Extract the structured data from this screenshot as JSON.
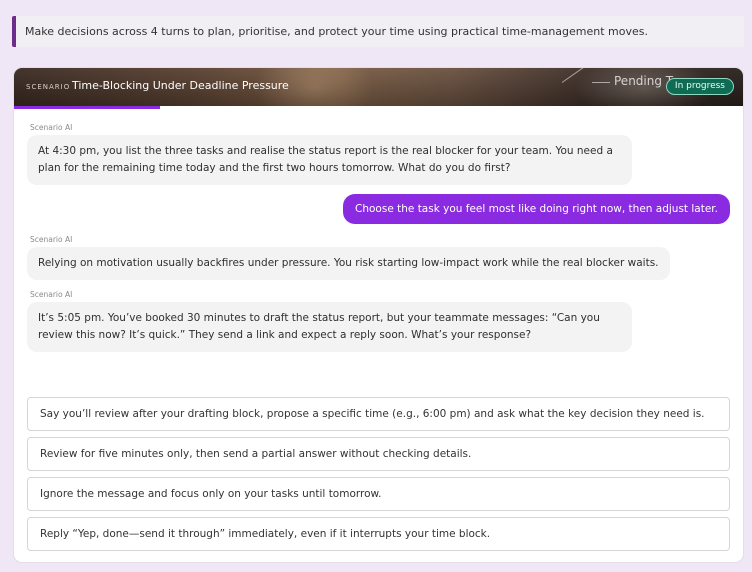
{
  "intro": {
    "text": "Make decisions across 4 turns to plan, prioritise, and protect your time using practical time-management moves."
  },
  "scenario": {
    "eyebrow": "Scenario",
    "title": "Time-Blocking Under Deadline Pressure",
    "banner_note": "Pending Tas",
    "status_badge": "In progress",
    "progress_fraction": 0.2,
    "accent_color": "#8a2be2",
    "badge_color": "#0f6b53"
  },
  "chat": {
    "sender_label": "Scenario AI",
    "messages": [
      {
        "role": "ai",
        "text": "At 4:30 pm, you list the three tasks and realise the status report is the real blocker for your team. You need a plan for the remaining time today and the first two hours tomorrow. What do you do first?"
      },
      {
        "role": "user",
        "text": "Choose the task you feel most like doing right now, then adjust later."
      },
      {
        "role": "ai",
        "text": "Relying on motivation usually backfires under pressure. You risk starting low-impact work while the real blocker waits."
      },
      {
        "role": "ai",
        "text": "It’s 5:05 pm. You’ve booked 30 minutes to draft the status report, but your teammate messages: “Can you review this now? It’s quick.” They send a link and expect a reply soon. What’s your response?"
      }
    ]
  },
  "options": [
    "Say you’ll review after your drafting block, propose a specific time (e.g., 6:00 pm) and ask what the key decision they need is.",
    "Review for five minutes only, then send a partial answer without checking details.",
    "Ignore the message and focus only on your tasks until tomorrow.",
    "Reply “Yep, done—send it through” immediately, even if it interrupts your time block."
  ]
}
